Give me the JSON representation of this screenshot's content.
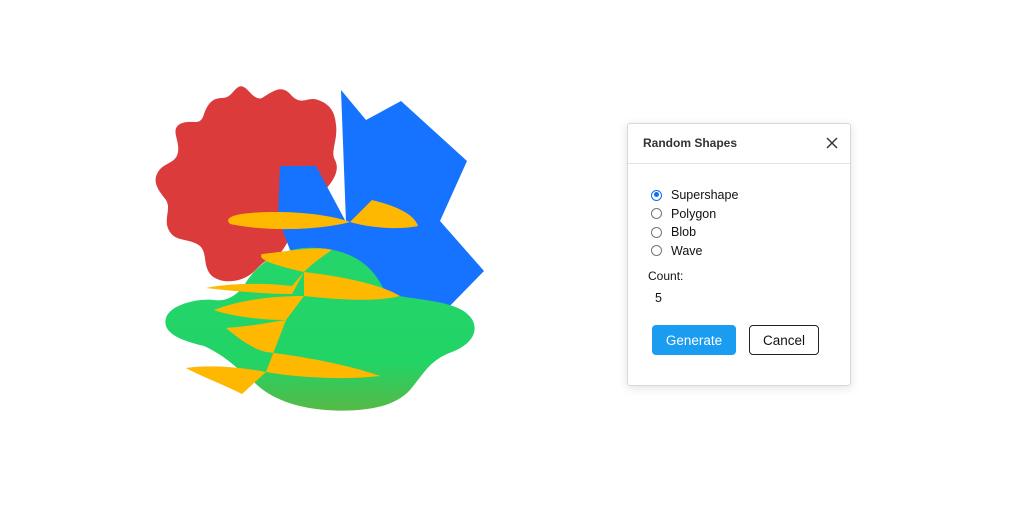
{
  "art": {
    "colors": {
      "red": "#db3b3b",
      "blue": "#1673ff",
      "green_top": "#24d66a",
      "green_bottom": "#55b947",
      "yellow": "#ffb800"
    }
  },
  "dialog": {
    "title": "Random Shapes",
    "close_icon": "close-icon",
    "options": [
      {
        "label": "Supershape",
        "checked": true
      },
      {
        "label": "Polygon",
        "checked": false
      },
      {
        "label": "Blob",
        "checked": false
      },
      {
        "label": "Wave",
        "checked": false
      }
    ],
    "count_label": "Count:",
    "count_value": "5",
    "generate_label": "Generate",
    "cancel_label": "Cancel",
    "accent_color": "#1a9cf0"
  }
}
